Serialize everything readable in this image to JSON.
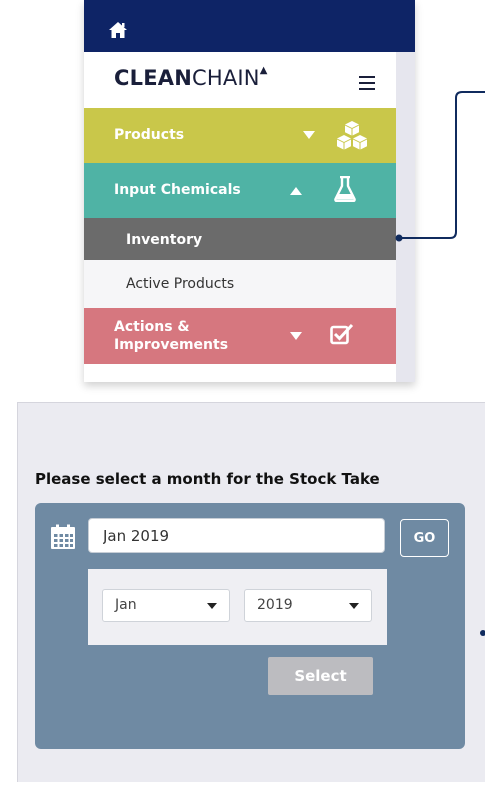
{
  "brand": {
    "bold": "CLEAN",
    "light": "CHAIN",
    "mark": "▲"
  },
  "nav": {
    "products": "Products",
    "input_chemicals": "Input Chemicals",
    "inventory": "Inventory",
    "active_products": "Active Products",
    "actions_line1": "Actions &",
    "actions_line2": "Improvements"
  },
  "stock_take": {
    "title": "Please select a month for the Stock Take",
    "date_value": "Jan 2019",
    "go_label": "GO",
    "month_selected": "Jan",
    "year_selected": "2019",
    "select_label": "Select"
  },
  "colors": {
    "topbar": "#0e2466",
    "products": "#c9c74a",
    "input_chemicals": "#4fb3a5",
    "inventory": "#6b6b6b",
    "actions": "#d6777f",
    "stock_box": "#6f8aa3"
  },
  "icons": {
    "home": "home-icon",
    "menu": "hamburger-menu-icon",
    "products": "boxes-icon",
    "chemicals": "flask-icon",
    "actions": "checkbox-icon",
    "calendar": "calendar-icon"
  }
}
